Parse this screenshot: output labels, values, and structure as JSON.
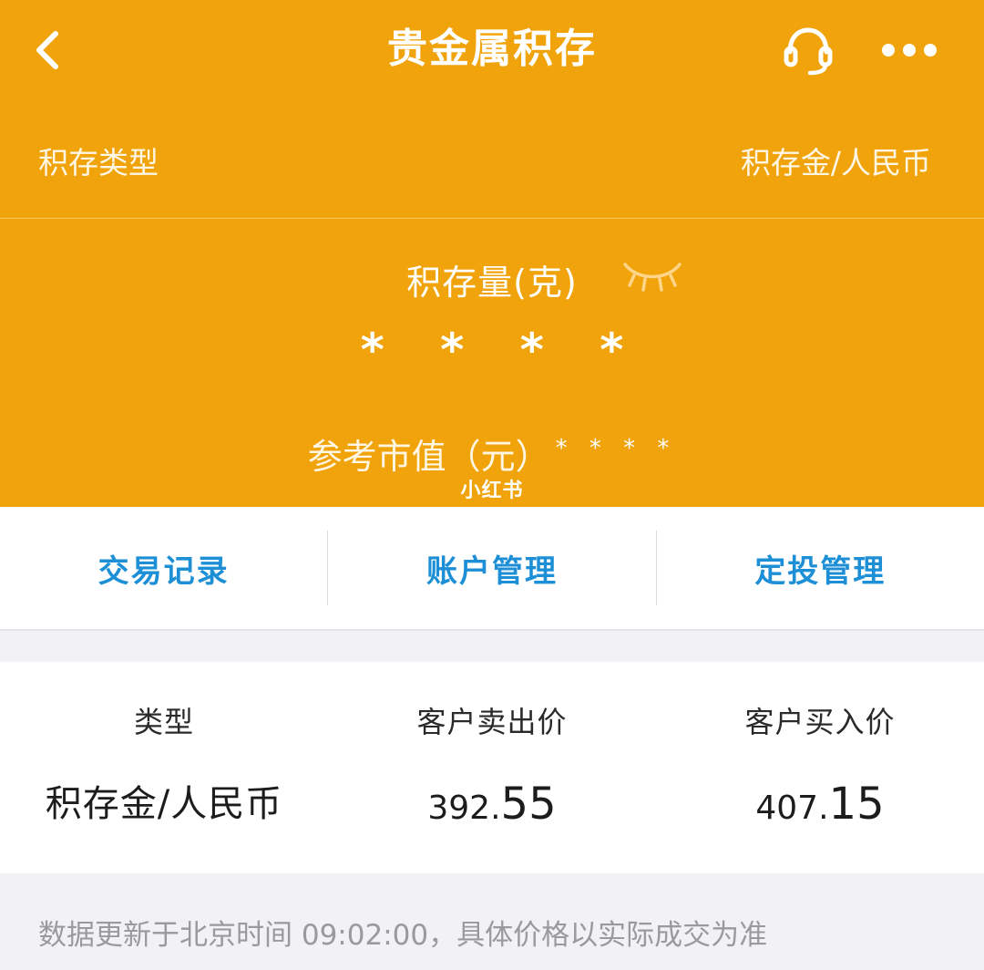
{
  "colors": {
    "header_bg": "#f0a30a",
    "accent_link": "#1d8fd6",
    "page_bg": "#f2f2f4"
  },
  "nav": {
    "back_icon": "chevron-left-icon",
    "title": "贵金属积存",
    "service_icon": "headset-icon",
    "more_icon": "more-dots-icon"
  },
  "account": {
    "type_label": "积存类型",
    "type_value": "积存金/人民币",
    "holdings_label": "积存量(克)",
    "holdings_value": "* * * *",
    "eye_icon": "closed-eye-icon",
    "market_label": "参考市值（元）",
    "market_value": "* * * *",
    "watermark": "小红书"
  },
  "actions": [
    {
      "label": "交易记录"
    },
    {
      "label": "账户管理"
    },
    {
      "label": "定投管理"
    }
  ],
  "price_table": {
    "headers": [
      "类型",
      "客户卖出价",
      "客户买入价"
    ],
    "row": {
      "type": "积存金/人民币",
      "sell_int": "392.",
      "sell_dec": "55",
      "buy_int": "407.",
      "buy_dec": "15"
    }
  },
  "footer": {
    "note": "数据更新于北京时间 09:02:00，具体价格以实际成交为准"
  }
}
